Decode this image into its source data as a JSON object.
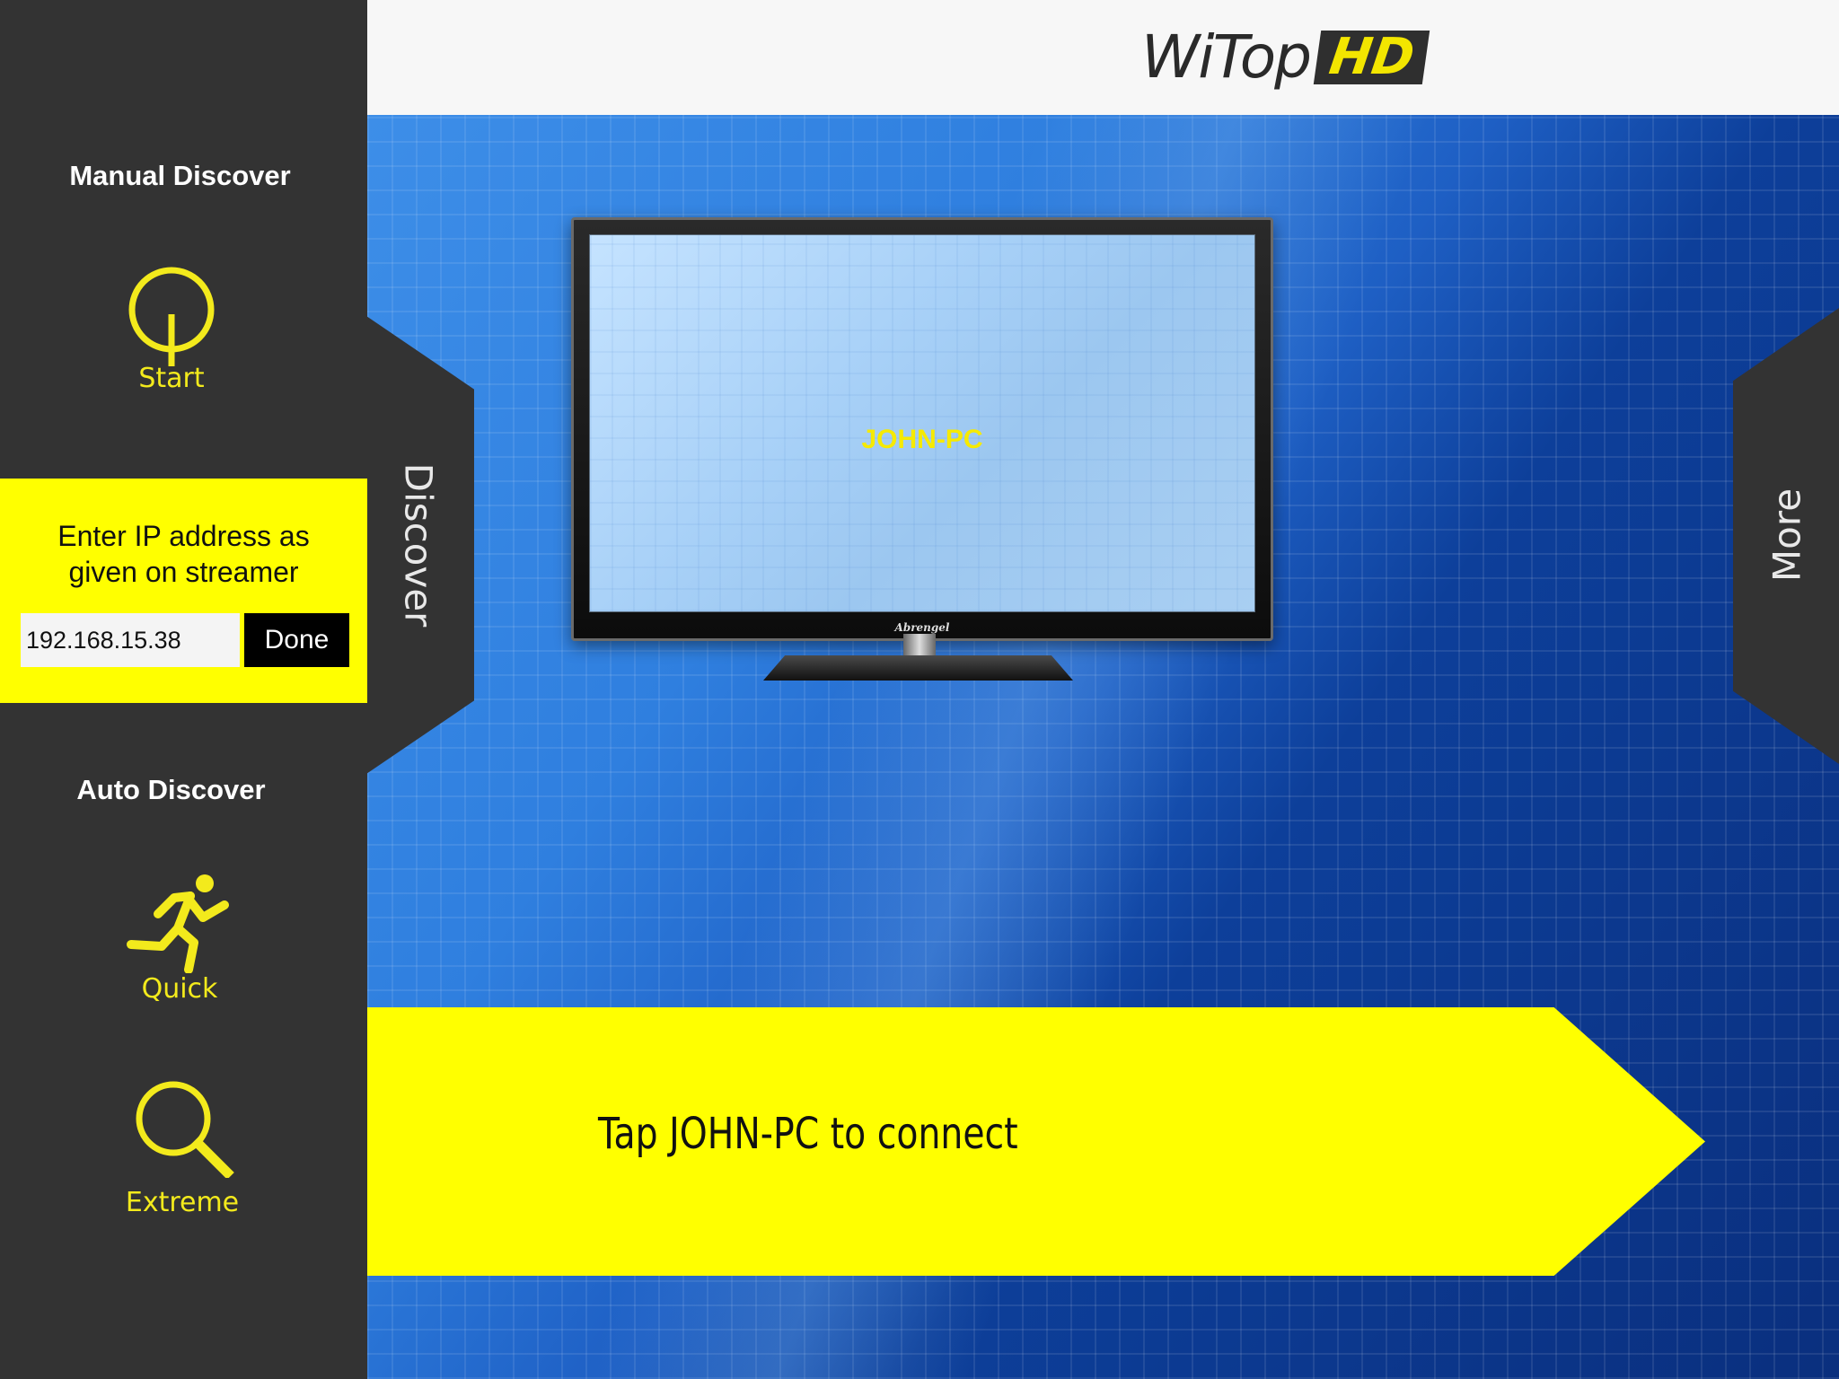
{
  "header": {
    "logo_word": "WiTop",
    "logo_badge": "HD"
  },
  "tv": {
    "device_name": "JOHN-PC",
    "brand": "Abrengel"
  },
  "banner": {
    "message": "Tap JOHN-PC to connect"
  },
  "tabs": {
    "discover_label": "Discover",
    "more_label": "More"
  },
  "sidebar": {
    "manual_title": "Manual Discover",
    "start_label": "Start",
    "ip_prompt_line1": "Enter IP address as",
    "ip_prompt_line2": "given on streamer",
    "ip_value": "192.168.15.38",
    "done_label": "Done",
    "auto_title": "Auto Discover",
    "quick_label": "Quick",
    "extreme_label": "Extreme"
  },
  "colors": {
    "accent_yellow": "#ffff00",
    "icon_yellow": "#f3ea1c",
    "sidebar_bg": "#333333",
    "header_bg": "#f7f7f7"
  },
  "icons": [
    "power-icon",
    "running-man-icon",
    "search-icon"
  ]
}
